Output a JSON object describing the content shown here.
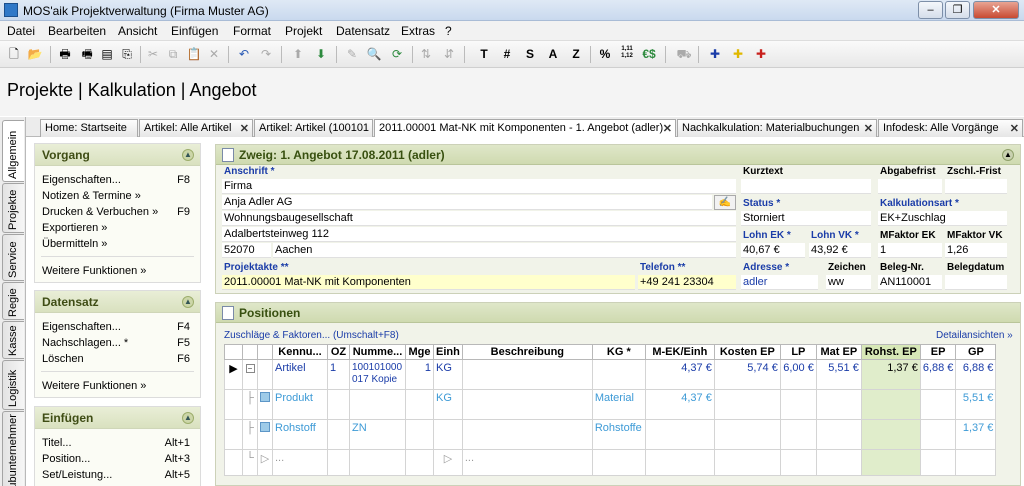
{
  "window": {
    "title": "MOS'aik Projektverwaltung (Firma Muster AG)"
  },
  "menu": [
    "Datei",
    "Bearbeiten",
    "Ansicht",
    "Einfügen",
    "Format",
    "Projekt",
    "Datensatz",
    "Extras",
    "?"
  ],
  "toolbar": {
    "text_buttons": [
      "T",
      "#",
      "S",
      "A",
      "Z",
      "%",
      "1,11 1,12",
      "€$"
    ]
  },
  "header": {
    "title": "Projekte | Kalkulation | Angebot"
  },
  "side_tabs": [
    "Allgemein",
    "Projekte",
    "Service",
    "Regie",
    "Kasse",
    "Logistik",
    "Subunternehmer"
  ],
  "doc_tabs": [
    {
      "label": "Home: Startseite",
      "closable": false
    },
    {
      "label": "Artikel: Alle Artikel",
      "closable": true
    },
    {
      "label": "Artikel: Artikel (100101",
      "closable": false
    },
    {
      "label": "2011.00001 Mat-NK mit Komponenten - 1. Angebot (adler)",
      "closable": true,
      "active": true
    },
    {
      "label": "Nachkalkulation: Materialbuchungen",
      "closable": true
    },
    {
      "label": "Infodesk: Alle Vorgänge",
      "closable": true
    }
  ],
  "left_panel": {
    "vorgang": {
      "title": "Vorgang",
      "items": [
        {
          "label": "Eigenschaften...",
          "key": "F8"
        },
        {
          "label": "Notizen & Termine »",
          "key": ""
        },
        {
          "label": "Drucken & Verbuchen »",
          "key": "F9"
        },
        {
          "label": "Exportieren »",
          "key": ""
        },
        {
          "label": "Übermitteln »",
          "key": ""
        }
      ],
      "more": "Weitere Funktionen »"
    },
    "datensatz": {
      "title": "Datensatz",
      "items": [
        {
          "label": "Eigenschaften...",
          "key": "F4"
        },
        {
          "label": "Nachschlagen... *",
          "key": "F5"
        },
        {
          "label": "Löschen",
          "key": "F6"
        }
      ],
      "more": "Weitere Funktionen »"
    },
    "einfuegen": {
      "title": "Einfügen",
      "items": [
        {
          "label": "Titel...",
          "key": "Alt+1"
        },
        {
          "label": "Position...",
          "key": "Alt+3"
        },
        {
          "label": "Set/Leistung...",
          "key": "Alt+5"
        }
      ]
    }
  },
  "zweig": {
    "title": "Zweig: 1. Angebot 17.08.2011 (adler)",
    "anschrift_label": "Anschrift *",
    "anschrift": [
      "Firma",
      "Anja Adler AG",
      "Wohnungsbaugesellschaft",
      "Adalbertsteinweg 112"
    ],
    "plz": "52070",
    "ort": "Aachen",
    "projektakte_label": "Projektakte **",
    "projektakte": "2011.00001 Mat-NK mit Komponenten",
    "telefon_label": "Telefon **",
    "telefon": "+49 241 23304",
    "kurztext_label": "Kurztext",
    "kurztext": "",
    "abgabefrist_label": "Abgabefrist",
    "abgabefrist": "",
    "zschl_label": "Zschl.-Frist",
    "zschl": "",
    "status_label": "Status *",
    "status": "Storniert",
    "kalkart_label": "Kalkulationsart *",
    "kalkart": "EK+Zuschlag",
    "lohn_ek_label": "Lohn EK *",
    "lohn_ek": "40,67 €",
    "lohn_vk_label": "Lohn VK *",
    "lohn_vk": "43,92 €",
    "mfaktor_ek_label": "MFaktor EK",
    "mfaktor_ek": "1",
    "mfaktor_vk_label": "MFaktor VK",
    "mfaktor_vk": "1,26",
    "adresse_label": "Adresse *",
    "adresse": "adler",
    "zeichen_label": "Zeichen",
    "zeichen": "ww",
    "belegnr_label": "Beleg-Nr.",
    "belegnr": "AN110001",
    "belegdatum_label": "Belegdatum",
    "belegdatum": ""
  },
  "positionen": {
    "title": "Positionen",
    "zuschlaege_link": "Zuschläge & Faktoren... (Umschalt+F8)",
    "details_link": "Detailansichten »",
    "columns": [
      "Kennu...",
      "OZ",
      "Numme...",
      "Mge",
      "Einh",
      "Beschreibung",
      "KG *",
      "M-EK/Einh",
      "Kosten EP",
      "LP",
      "Mat EP",
      "Rohst. EP",
      "EP",
      "GP"
    ],
    "rows": [
      {
        "kennung": "Artikel",
        "oz": "1",
        "nummer": "100101000 017 Kopie",
        "mge": "1",
        "einh": "KG",
        "beschreibung": "",
        "kg": "",
        "mek": "4,37 €",
        "kosten": "5,74 €",
        "lp": "6,00 €",
        "mat": "5,51 €",
        "rohst": "1,37 €",
        "ep": "6,88 €",
        "gp": "6,88 €"
      },
      {
        "kennung": "Produkt",
        "oz": "",
        "nummer": "",
        "mge": "",
        "einh": "KG",
        "beschreibung": "",
        "kg": "Material",
        "mek": "4,37 €",
        "kosten": "",
        "lp": "",
        "mat": "",
        "rohst": "",
        "ep": "",
        "gp": "5,51 €"
      },
      {
        "kennung": "Rohstoff",
        "oz": "",
        "nummer": "ZN",
        "mge": "",
        "einh": "",
        "beschreibung": "",
        "kg": "Rohstoffe",
        "mek": "",
        "kosten": "",
        "lp": "",
        "mat": "",
        "rohst": "",
        "ep": "",
        "gp": "1,37 €"
      },
      {
        "kennung": "...",
        "oz": "",
        "nummer": "",
        "mge": "",
        "einh": "",
        "beschreibung": "...",
        "kg": "",
        "mek": "",
        "kosten": "",
        "lp": "",
        "mat": "",
        "rohst": "",
        "ep": "",
        "gp": ""
      }
    ]
  }
}
